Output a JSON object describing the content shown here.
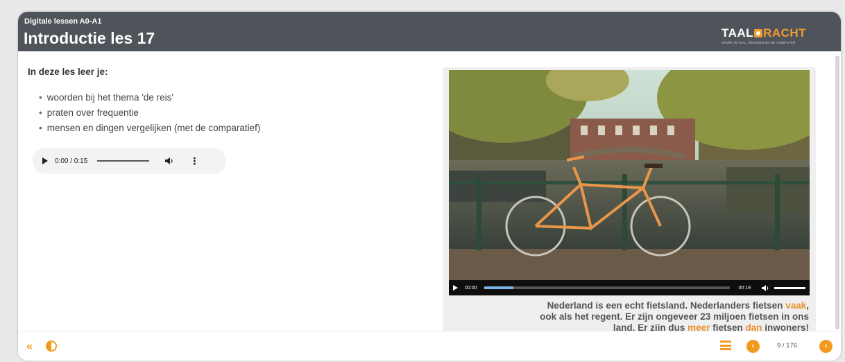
{
  "header": {
    "course": "Digitale lessen  A0-A1",
    "title": "Introductie les 17",
    "logo": {
      "part1": "TAAL",
      "part2": "RACHT",
      "tagline": "STERK IN TAAL, REKENEN EN DE COMPUTER"
    }
  },
  "main": {
    "intro": "In deze les leer je:",
    "bullets": [
      "woorden bij het thema 'de reis'",
      "praten over frequentie",
      "mensen en dingen vergelijken (met de comparatief)"
    ]
  },
  "audio": {
    "time": "0:00 / 0:15",
    "progress": 0
  },
  "video": {
    "current": "00:00",
    "duration": "00:19",
    "progress": 0.12
  },
  "caption": {
    "s1": "Nederland is een echt fietsland. Nederlanders fietsen ",
    "h1": "vaak",
    "s2": ",",
    "s3": "ook als het regent. Er zijn ongeveer 23 miljoen fietsen in ons",
    "s4": "land. Er zijn dus ",
    "h2": "meer",
    "s5": " fietsen ",
    "h3": "dan",
    "s6": " inwoners!"
  },
  "footer": {
    "back": "«",
    "page": "9 / 176",
    "prev": "‹",
    "next": "›"
  },
  "colors": {
    "accent": "#f39a1e",
    "header": "#4f545b",
    "highlight": "#e8912a"
  },
  "icons": [
    "play-icon",
    "volume-icon",
    "more-icon",
    "double-chevron-left-icon",
    "contrast-icon",
    "menu-icon",
    "chevron-left-icon",
    "chevron-right-icon"
  ]
}
